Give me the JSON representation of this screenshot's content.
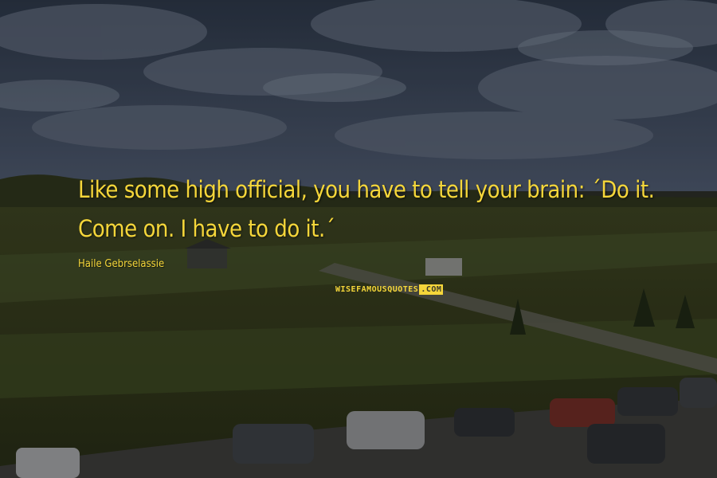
{
  "quote": {
    "lines": [
      "Like some high official, you have to tell your brain: ´Do it.",
      "Come on. I have to do it.´"
    ],
    "author": "Haile Gebrselassie"
  },
  "watermark": {
    "left": "WISEFAMOUSQUOTES",
    "right": ".COM"
  },
  "colors": {
    "text": "#f5d63a",
    "sky": "#3b4a5e",
    "field": "#3e4a22"
  }
}
